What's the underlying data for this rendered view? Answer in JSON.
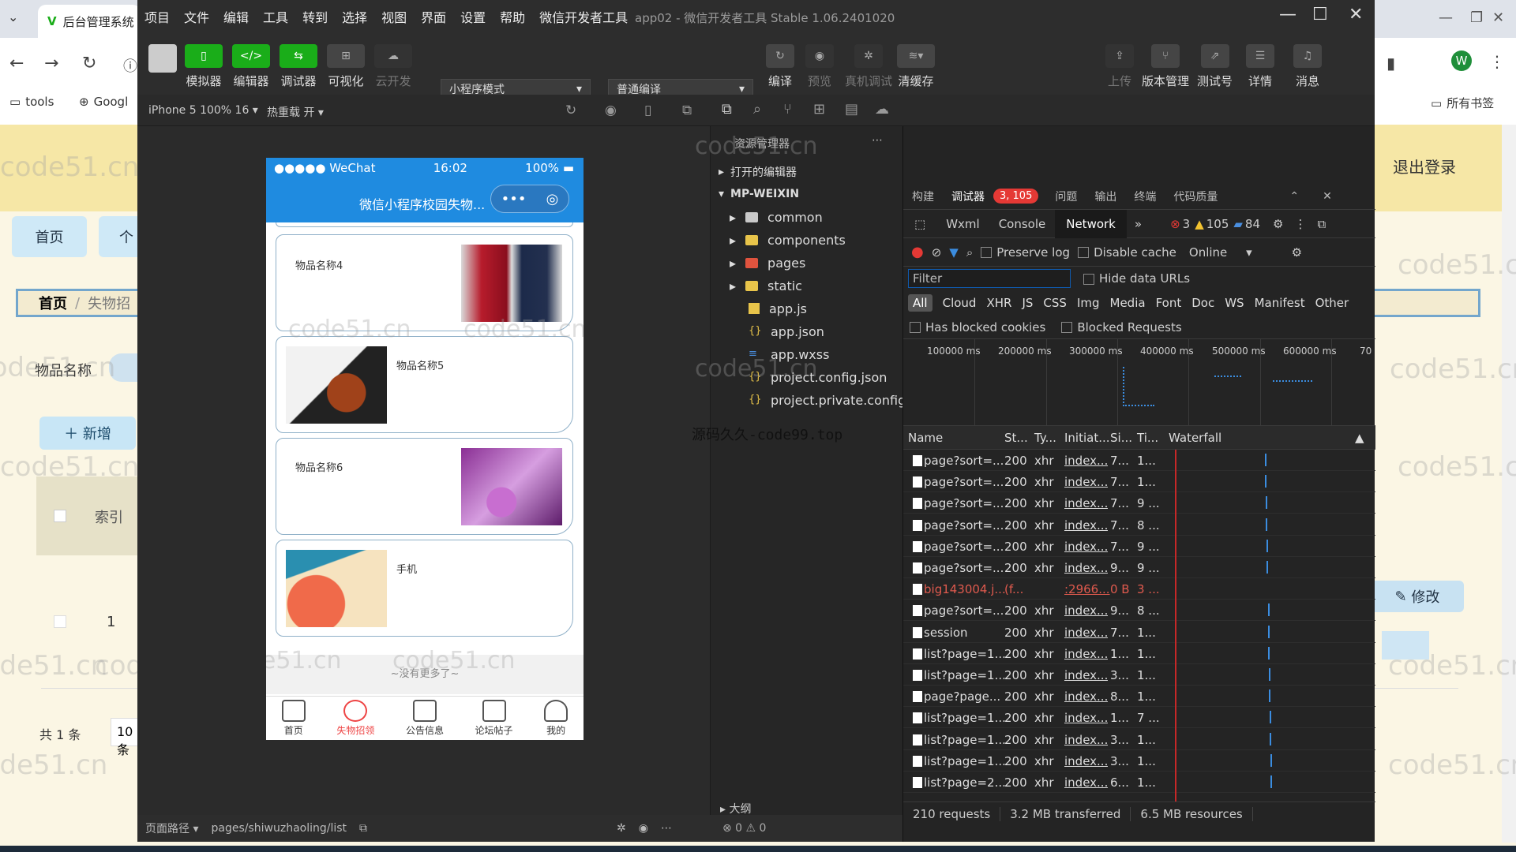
{
  "browser": {
    "tab_title": "后台管理系统",
    "bookmarks": [
      "tools",
      "Googl"
    ],
    "all_bookmarks": "所有书签",
    "avatar_letter": "W",
    "page": {
      "nav_home": "首页",
      "nav_more": "个",
      "breadcrumb_home": "首页",
      "breadcrumb_sep": "/",
      "breadcrumb_current": "失物招",
      "search_label": "物品名称",
      "add_button": "＋ 新增",
      "table_index_header": "索引",
      "row_index": "1",
      "total": "共 1 条",
      "page_size": "10条",
      "logout": "退出登录",
      "edit_button": "修改"
    }
  },
  "watermark": "code51.cn",
  "ide": {
    "menu": [
      "项目",
      "文件",
      "编辑",
      "工具",
      "转到",
      "选择",
      "视图",
      "界面",
      "设置",
      "帮助",
      "微信开发者工具"
    ],
    "title": "app02 - 微信开发者工具 Stable 1.06.2401020",
    "toolbar_left": [
      "模拟器",
      "编辑器",
      "调试器",
      "可视化",
      "云开发"
    ],
    "mode_select": "小程序模式",
    "compile_select": "普通编译",
    "toolbar_mid": [
      "编译",
      "预览",
      "真机调试",
      "清缓存"
    ],
    "toolbar_right": [
      "上传",
      "版本管理",
      "测试号",
      "详情",
      "消息"
    ],
    "device": "iPhone 5 100% 16",
    "hot_reload": "热重载 开"
  },
  "phone": {
    "signal": "●●●●● WeChat",
    "time": "16:02",
    "battery": "100%",
    "title": "微信小程序校园失物...",
    "items": [
      {
        "name": "物品名称4"
      },
      {
        "name": "物品名称5"
      },
      {
        "name": "物品名称6"
      },
      {
        "name": "手机"
      }
    ],
    "no_more": "~没有更多了~",
    "tabs": [
      "首页",
      "失物招领",
      "公告信息",
      "论坛帖子",
      "我的"
    ]
  },
  "sim_footer": {
    "path_label": "页面路径",
    "path": "pages/shiwuzhaoling/list"
  },
  "explorer": {
    "header": "资源管理器",
    "open_editors": "打开的编辑器",
    "root": "MP-WEIXIN",
    "folders": [
      "common",
      "components",
      "pages",
      "static"
    ],
    "files": [
      "app.js",
      "app.json",
      "app.wxss",
      "project.config.json",
      "project.private.config.js..."
    ],
    "outline": "大纲",
    "status": "⊗ 0 ⚠ 0"
  },
  "overlay_text": "源码久久-code99.top",
  "devtools": {
    "top_tabs": [
      "构建",
      "调试器",
      "问题",
      "输出",
      "终端",
      "代码质量"
    ],
    "badge": "3, 105",
    "panel_tabs": [
      "Wxml",
      "Console",
      "Network"
    ],
    "counts": {
      "errors": "3",
      "warnings": "105",
      "info": "84"
    },
    "preserve_log": "Preserve log",
    "disable_cache": "Disable cache",
    "throttle": "Online",
    "filter_placeholder": "Filter",
    "hide_data_urls": "Hide data URLs",
    "types": [
      "All",
      "Cloud",
      "XHR",
      "JS",
      "CSS",
      "Img",
      "Media",
      "Font",
      "Doc",
      "WS",
      "Manifest",
      "Other"
    ],
    "has_blocked": "Has blocked cookies",
    "blocked_requests": "Blocked Requests",
    "timeline_ticks": [
      "100000 ms",
      "200000 ms",
      "300000 ms",
      "400000 ms",
      "500000 ms",
      "600000 ms",
      "70"
    ],
    "columns": [
      "Name",
      "St...",
      "Ty...",
      "Initiat...",
      "Si...",
      "Ti...",
      "Waterfall"
    ],
    "rows": [
      {
        "name": "page?sort=...",
        "status": "200",
        "type": "xhr",
        "init": "index...",
        "size": "7...",
        "time": "1..."
      },
      {
        "name": "page?sort=...",
        "status": "200",
        "type": "xhr",
        "init": "index...",
        "size": "7...",
        "time": "1..."
      },
      {
        "name": "page?sort=...",
        "status": "200",
        "type": "xhr",
        "init": "index...",
        "size": "7...",
        "time": "9 ..."
      },
      {
        "name": "page?sort=...",
        "status": "200",
        "type": "xhr",
        "init": "index...",
        "size": "7...",
        "time": "8 ..."
      },
      {
        "name": "page?sort=...",
        "status": "200",
        "type": "xhr",
        "init": "index...",
        "size": "7...",
        "time": "9 ..."
      },
      {
        "name": "page?sort=...",
        "status": "200",
        "type": "xhr",
        "init": "index...",
        "size": "9...",
        "time": "9 ..."
      },
      {
        "name": "big143004.j...",
        "status": "(f...",
        "type": "",
        "init": ":2966...",
        "size": "0 B",
        "time": "3 ..."
      },
      {
        "name": "page?sort=...",
        "status": "200",
        "type": "xhr",
        "init": "index...",
        "size": "9...",
        "time": "8 ..."
      },
      {
        "name": "session",
        "status": "200",
        "type": "xhr",
        "init": "index...",
        "size": "7...",
        "time": "1..."
      },
      {
        "name": "list?page=1...",
        "status": "200",
        "type": "xhr",
        "init": "index...",
        "size": "1...",
        "time": "1..."
      },
      {
        "name": "list?page=1...",
        "status": "200",
        "type": "xhr",
        "init": "index...",
        "size": "3...",
        "time": "1..."
      },
      {
        "name": "page?page...",
        "status": "200",
        "type": "xhr",
        "init": "index...",
        "size": "8...",
        "time": "1..."
      },
      {
        "name": "list?page=1...",
        "status": "200",
        "type": "xhr",
        "init": "index...",
        "size": "1...",
        "time": "7 ..."
      },
      {
        "name": "list?page=1...",
        "status": "200",
        "type": "xhr",
        "init": "index...",
        "size": "3...",
        "time": "1..."
      },
      {
        "name": "list?page=1...",
        "status": "200",
        "type": "xhr",
        "init": "index...",
        "size": "3...",
        "time": "1..."
      },
      {
        "name": "list?page=2...",
        "status": "200",
        "type": "xhr",
        "init": "index...",
        "size": "6...",
        "time": "1..."
      }
    ],
    "footer": {
      "requests": "210 requests",
      "transferred": "3.2 MB transferred",
      "resources": "6.5 MB resources"
    }
  }
}
